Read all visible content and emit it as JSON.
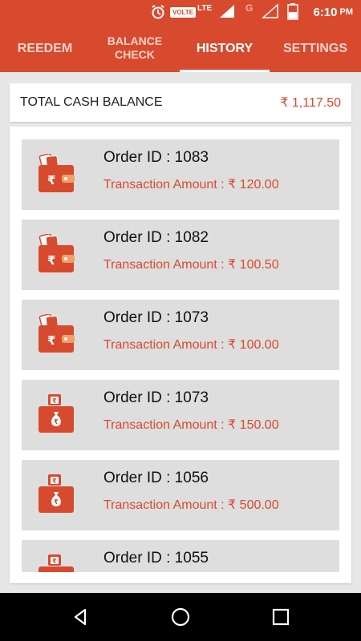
{
  "status_bar": {
    "volte": "VOLTE",
    "lte": "LTE",
    "network": "G",
    "time": "6:10",
    "ampm": "PM"
  },
  "tabs": [
    {
      "label": "REEDEM",
      "active": false
    },
    {
      "label": "BALANCE\nCHECK",
      "active": false
    },
    {
      "label": "HISTORY",
      "active": true
    },
    {
      "label": "SETTINGS",
      "active": false
    }
  ],
  "balance": {
    "label": "TOTAL CASH BALANCE",
    "value": "₹ 1,117.50"
  },
  "orders": [
    {
      "id": "Order ID : 1083",
      "amount": "Transaction Amount : ₹ 120.00",
      "icon": "wallet-icon"
    },
    {
      "id": "Order ID : 1082",
      "amount": "Transaction Amount : ₹ 100.50",
      "icon": "wallet-icon"
    },
    {
      "id": "Order ID : 1073",
      "amount": "Transaction Amount : ₹ 100.00",
      "icon": "wallet-icon"
    },
    {
      "id": "Order ID : 1073",
      "amount": "Transaction Amount : ₹ 150.00",
      "icon": "money-bag-icon"
    },
    {
      "id": "Order ID : 1056",
      "amount": "Transaction Amount : ₹ 500.00",
      "icon": "money-bag-icon"
    },
    {
      "id": "Order ID : 1055",
      "amount": "",
      "icon": "money-bag-icon"
    }
  ],
  "colors": {
    "accent": "#d84a2e",
    "background": "#e7e7e7",
    "item_bg": "#dedede"
  }
}
